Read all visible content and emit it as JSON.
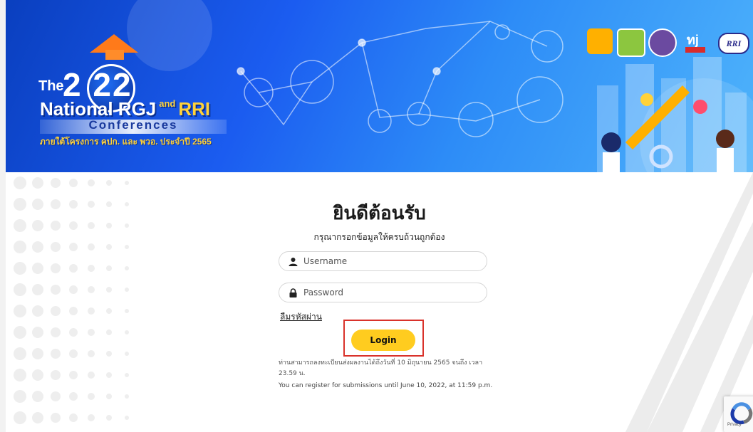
{
  "banner": {
    "logo": {
      "the": "The",
      "year": "2  22",
      "national": "National RGJ",
      "and": "and",
      "rri": "RRI",
      "conferences": "Conferences",
      "subtitle": "ภายใต้โครงการ คปก. และ พวอ. ประจำปี 2565"
    },
    "partner_rri": "RRI",
    "partner_colors": [
      "#ffb000",
      "#8cc63f",
      "#6b4aa0",
      "#d92b2b"
    ]
  },
  "login": {
    "title": "ยินดีต้อนรับ",
    "subtitle": "กรุณากรอกข้อมูลให้ครบถ้วนถูกต้อง",
    "username_placeholder": "Username",
    "password_placeholder": "Password",
    "forgot_password": "ลืมรหัสผ่าน",
    "login_button": "Login",
    "note_th": "ท่านสามารถลงทะเบียนส่งผลงานได้ถึงวันที่ 10 มิถุนายน 2565 จนถึง เวลา 23.59 น.",
    "note_en": "You can register for submissions until June 10, 2022, at 11:59 p.m."
  },
  "recaptcha": {
    "label": "Privacy"
  },
  "colors": {
    "accent_button": "#ffcc1f",
    "highlight_outline": "#d9322b",
    "banner_blue": "#1b5cf0"
  }
}
